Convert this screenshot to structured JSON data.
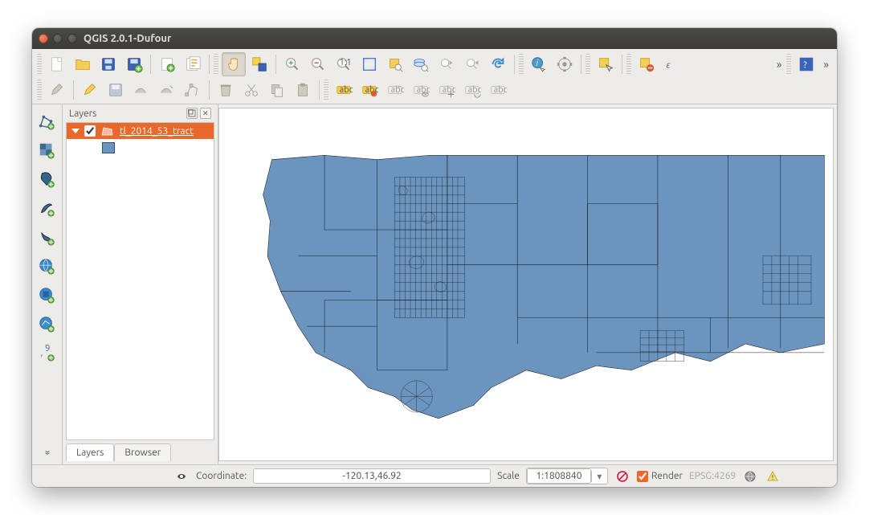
{
  "window": {
    "title": "QGIS 2.0.1-Dufour"
  },
  "panels": {
    "layers_title": "Layers",
    "tabs": {
      "layers": "Layers",
      "browser": "Browser"
    }
  },
  "layer": {
    "name": "tl_2014_53_tract",
    "checked": true,
    "fill_color": "#6b94bf",
    "outline_color": "#2e5277"
  },
  "status": {
    "coordinate_label": "Coordinate:",
    "coordinate_value": "-120.13,46.92",
    "scale_label": "Scale",
    "scale_value": "1:1808840",
    "render_label": "Render",
    "epsg": "EPSG:4269"
  },
  "colors": {
    "accent": "#e9692c"
  }
}
